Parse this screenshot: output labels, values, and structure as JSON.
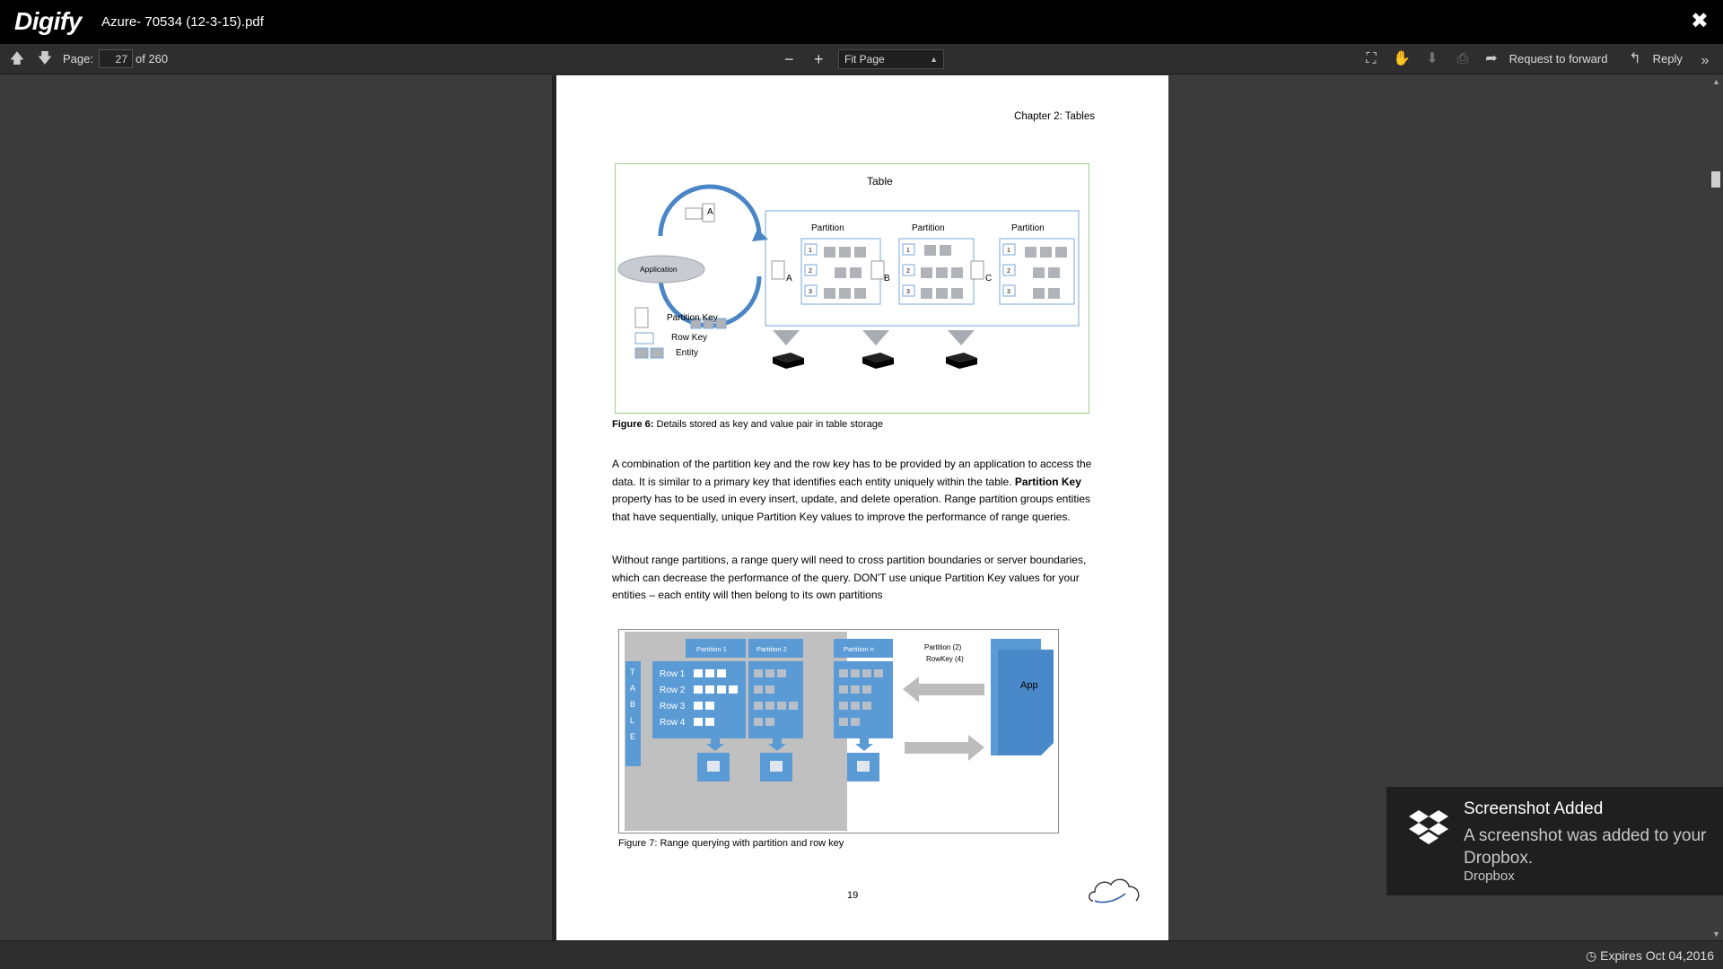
{
  "app": {
    "brand": "Digify",
    "document_title": "Azure- 70534 (12-3-15).pdf",
    "close_icon": "close-icon"
  },
  "toolbar": {
    "page_label": "Page:",
    "current_page": "27",
    "total_pages_label": "of 260",
    "zoom_selected": "Fit Page",
    "request_forward_label": "Request to forward",
    "reply_label": "Reply"
  },
  "document": {
    "chapter_header": "Chapter 2: Tables",
    "figure6": {
      "title": "Table",
      "partition_labels": [
        "Partition",
        "Partition",
        "Partition"
      ],
      "partition_letters": [
        "A",
        "B",
        "C"
      ],
      "row_numbers": [
        "1",
        "2",
        "3"
      ],
      "app_label": "Application",
      "arrow_letter": "A",
      "legend": {
        "partition_key": "Partition Key",
        "row_key": "Row Key",
        "entity": "Entity"
      },
      "caption_bold": "Figure 6:",
      "caption": " Details stored as key and value pair in table storage"
    },
    "paragraph1": {
      "part1": "A combination of the partition key and the row key has to be provided by an application to access the data. It is similar to a primary key that identifies each entity uniquely within the table. ",
      "bold": "Partition Key",
      "part2": " property has to be used in every insert, update, and delete operation. Range partition groups entities that have sequentially, unique Partition Key values to improve the performance of range queries."
    },
    "paragraph2": "Without range partitions, a range query will need to cross partition boundaries or server boundaries, which can decrease the performance of the query. DON'T use unique Partition Key values for your entities – each entity will then belong to its own partitions",
    "figure7": {
      "table_letters": [
        "T",
        "A",
        "B",
        "L",
        "E"
      ],
      "partition_headers": [
        "Partition 1",
        "Partition 2",
        "Partition n"
      ],
      "rows": [
        "Row 1",
        "Row 2",
        "Row 3",
        "Row 4"
      ],
      "query_label_line1": "Partition (2)",
      "query_label_line2": "RowKey (4)",
      "app_label": "App",
      "caption": "Figure 7: Range querying with partition and row key"
    },
    "page_number": "19"
  },
  "status": {
    "expires": "Expires Oct 04,2016"
  },
  "toast": {
    "title": "Screenshot Added",
    "body": "A screenshot was added to your Dropbox.",
    "source": "Dropbox"
  }
}
